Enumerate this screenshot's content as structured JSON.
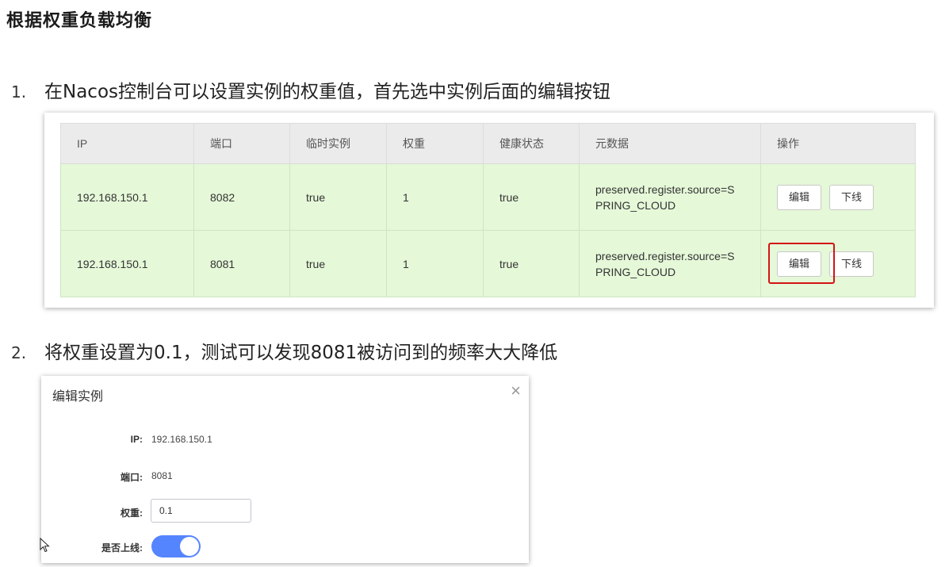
{
  "heading": "根据权重负载均衡",
  "steps": [
    {
      "num": "1.",
      "text": "在Nacos控制台可以设置实例的权重值，首先选中实例后面的编辑按钮"
    },
    {
      "num": "2.",
      "text": "将权重设置为0.1，测试可以发现8081被访问到的频率大大降低"
    }
  ],
  "table": {
    "headers": [
      "IP",
      "端口",
      "临时实例",
      "权重",
      "健康状态",
      "元数据",
      "操作"
    ],
    "rows": [
      {
        "ip": "192.168.150.1",
        "port": "8082",
        "ephemeral": "true",
        "weight": "1",
        "healthy": "true",
        "meta_line1": "preserved.register.source=S",
        "meta_line2": "PRING_CLOUD",
        "edit": "编辑",
        "offline": "下线"
      },
      {
        "ip": "192.168.150.1",
        "port": "8081",
        "ephemeral": "true",
        "weight": "1",
        "healthy": "true",
        "meta_line1": "preserved.register.source=S",
        "meta_line2": "PRING_CLOUD",
        "edit": "编辑",
        "offline": "下线"
      }
    ],
    "row_color": "#e5f8d8",
    "highlight_color": "#d21414"
  },
  "dialog": {
    "title": "编辑实例",
    "close_icon": "×",
    "ip_label": "IP:",
    "ip_value": "192.168.150.1",
    "port_label": "端口:",
    "port_value": "8081",
    "weight_label": "权重:",
    "weight_value": "0.1",
    "online_label": "是否上线:",
    "online_enabled": true,
    "toggle_color": "#5584ff"
  }
}
